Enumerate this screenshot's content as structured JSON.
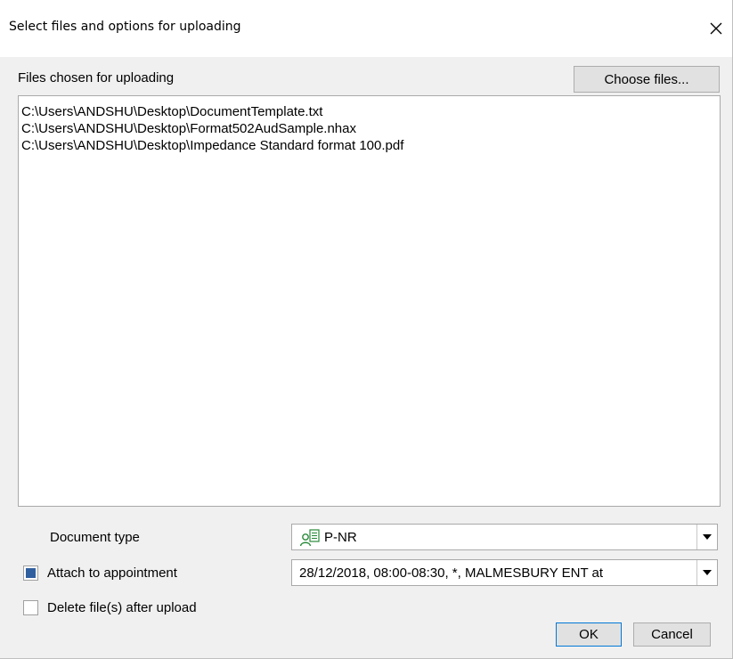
{
  "dialog": {
    "title": "Select files and options for uploading",
    "files_label": "Files chosen for uploading",
    "choose_files_label": "Choose files...",
    "files": [
      "C:\\Users\\ANDSHU\\Desktop\\DocumentTemplate.txt",
      "C:\\Users\\ANDSHU\\Desktop\\Format502AudSample.nhax",
      "C:\\Users\\ANDSHU\\Desktop\\Impedance Standard format 100.pdf"
    ],
    "document_type_label": "Document type",
    "document_type_value": "P-NR",
    "attach_label": "Attach to appointment",
    "attach_checked": true,
    "appointment_value": "28/12/2018, 08:00-08:30, *, MALMESBURY ENT at",
    "delete_label": "Delete file(s) after upload",
    "delete_checked": false,
    "ok_label": "OK",
    "cancel_label": "Cancel"
  },
  "icons": {
    "close": "close-icon",
    "dropdown": "chevron-down-icon",
    "document_type": "person-document-icon"
  },
  "colors": {
    "checkbox_fill": "#2f5f9f",
    "default_button_border": "#0078d7",
    "doc_icon": "#2a8a3a"
  }
}
